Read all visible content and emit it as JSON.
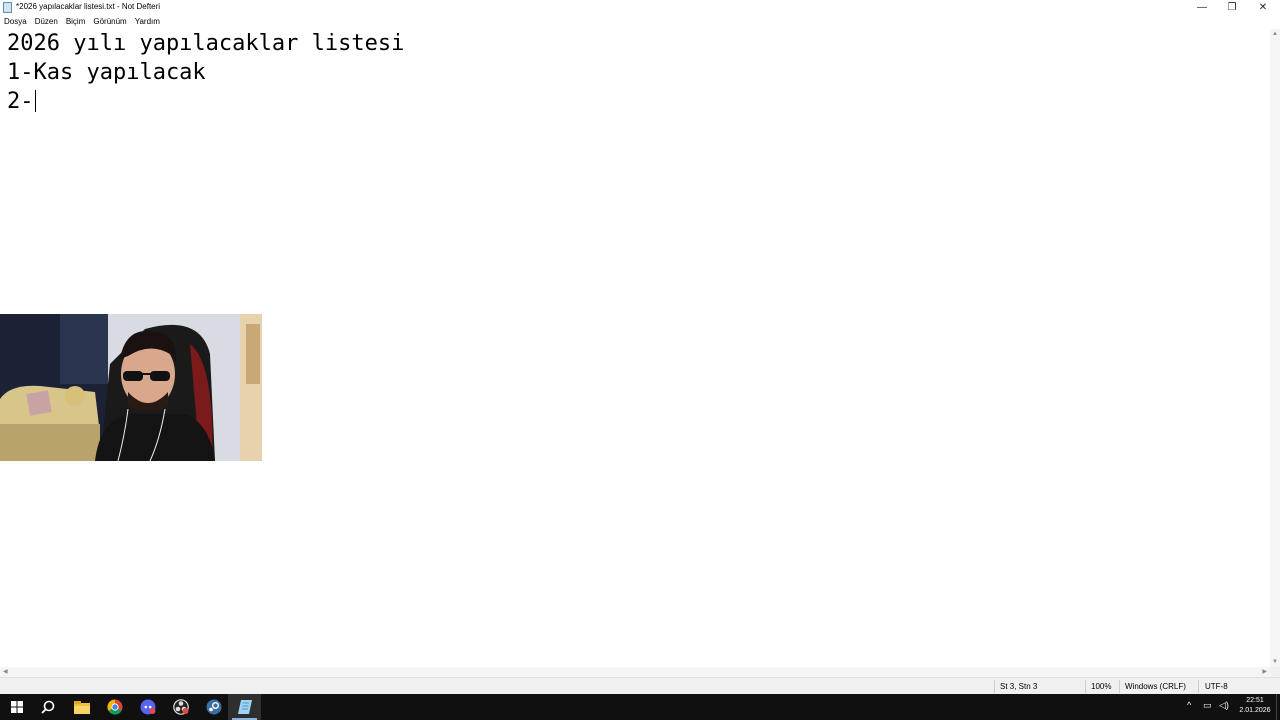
{
  "window": {
    "title": "*2026 yapılacaklar listesi.txt - Not Defteri",
    "controls": {
      "minimize": "—",
      "maximize": "❐",
      "close": "✕"
    }
  },
  "menu": [
    "Dosya",
    "Düzen",
    "Biçim",
    "Görünüm",
    "Yardım"
  ],
  "editor": {
    "lines": [
      "2026 yılı yapılacaklar listesi",
      "1-Kas yapılacak",
      "2-"
    ]
  },
  "statusbar": {
    "position": "St 3, Stn 3",
    "zoom": "100%",
    "line_ending": "Windows (CRLF)",
    "encoding": "UTF-8"
  },
  "taskbar": {
    "apps": [
      "start-icon",
      "search-icon",
      "file-explorer-icon",
      "chrome-icon",
      "discord-icon",
      "obs-icon",
      "steam-icon",
      "notepad-icon"
    ],
    "tray_icons": [
      "chevron-up-icon",
      "network-icon",
      "volume-icon"
    ],
    "time": "22:51",
    "date": "2.01.2026"
  }
}
